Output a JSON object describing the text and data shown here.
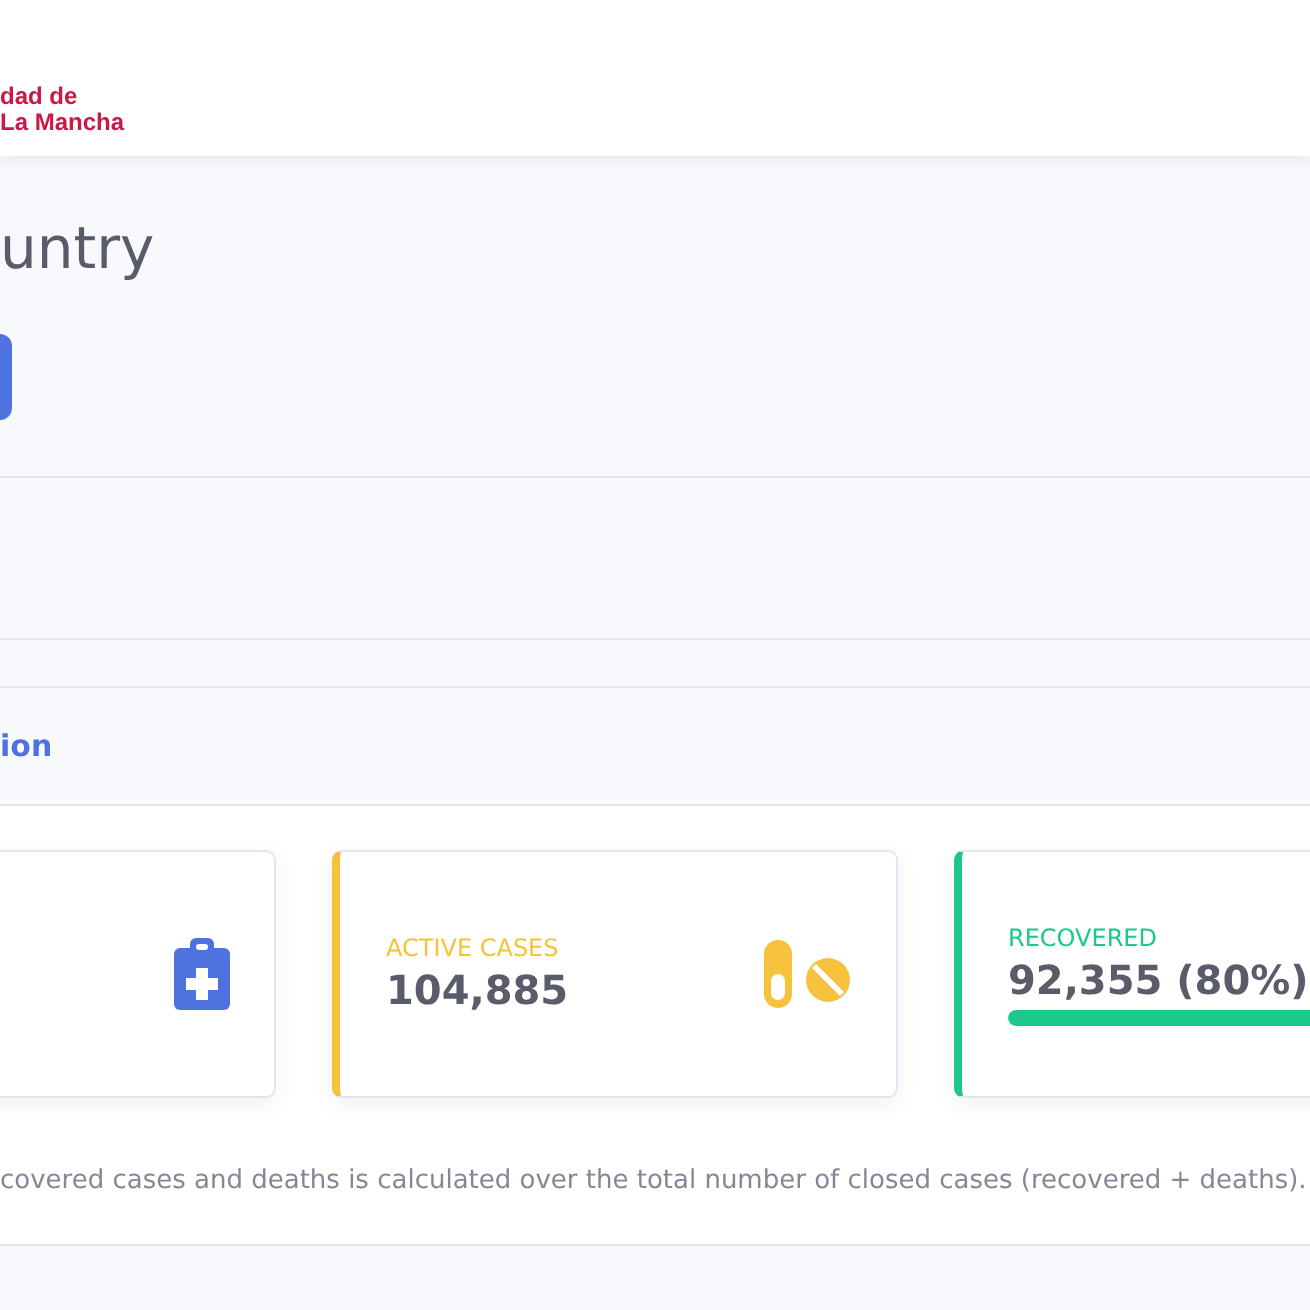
{
  "header": {
    "logo_lines": [
      "dad de",
      "La Mancha"
    ]
  },
  "page": {
    "title": "untry"
  },
  "section": {
    "title": "ion"
  },
  "cards": [
    {
      "kind": "plain",
      "color": "#4e73df"
    },
    {
      "kind": "stat",
      "label": "ACTIVE CASES",
      "value": "104,885",
      "color": "#f6c23e"
    },
    {
      "kind": "progress",
      "label": "RECOVERED",
      "value": "92,355 (80%)",
      "level": 0.8,
      "color": "#1cc88a"
    }
  ],
  "note": "covered cases and deaths is calculated over the total number of closed cases (recovered + deaths)."
}
